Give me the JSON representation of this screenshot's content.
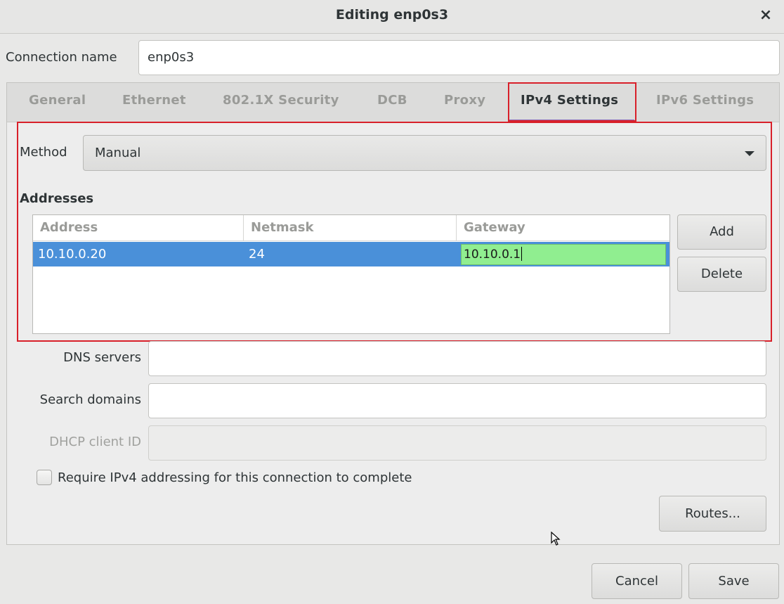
{
  "window": {
    "title": "Editing enp0s3",
    "close_glyph": "×"
  },
  "connection": {
    "label": "Connection name",
    "value": "enp0s3"
  },
  "tabs": [
    {
      "label": "General",
      "active": false
    },
    {
      "label": "Ethernet",
      "active": false
    },
    {
      "label": "802.1X Security",
      "active": false
    },
    {
      "label": "DCB",
      "active": false
    },
    {
      "label": "Proxy",
      "active": false
    },
    {
      "label": "IPv4 Settings",
      "active": true
    },
    {
      "label": "IPv6 Settings",
      "active": false
    }
  ],
  "ipv4": {
    "method_label": "Method",
    "method_value": "Manual",
    "addresses_heading": "Addresses",
    "columns": [
      "Address",
      "Netmask",
      "Gateway"
    ],
    "rows": [
      {
        "address": "10.10.0.20",
        "netmask": "24",
        "gateway": "10.10.0.1"
      }
    ],
    "add_label": "Add",
    "delete_label": "Delete",
    "dns_label": "DNS servers",
    "dns_value": "",
    "search_label": "Search domains",
    "search_value": "",
    "dhcp_label": "DHCP client ID",
    "dhcp_value": "",
    "require_label": "Require IPv4 addressing for this connection to complete",
    "require_checked": false,
    "routes_label": "Routes..."
  },
  "footer": {
    "cancel_label": "Cancel",
    "save_label": "Save"
  },
  "colors": {
    "selection": "#4a90d9",
    "edit_cell": "#90ee90",
    "highlight": "#d8202a",
    "tab_underline": "#8d6ab8"
  }
}
